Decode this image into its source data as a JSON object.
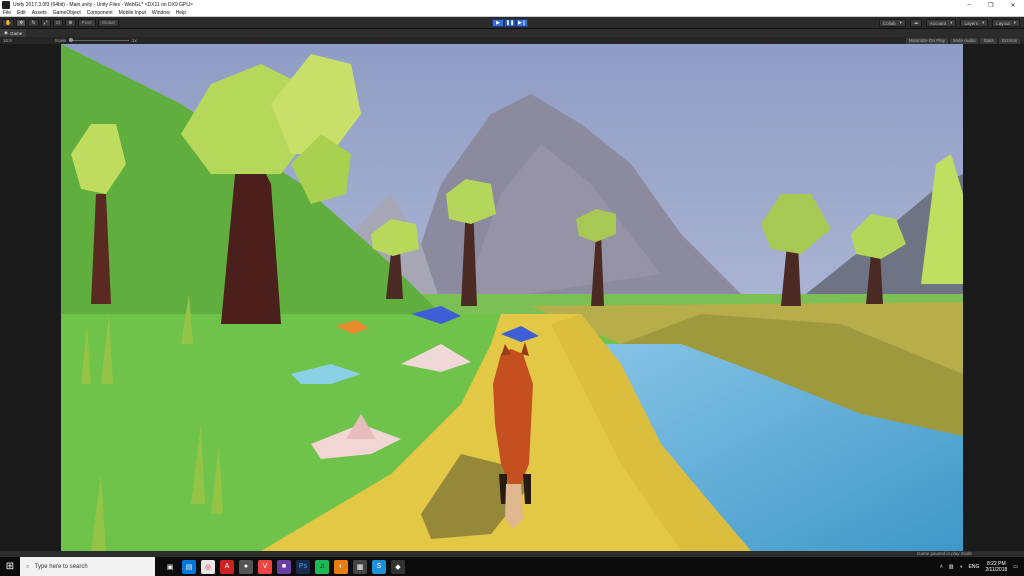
{
  "window": {
    "title": "Unity 2017.3.0f3 (64bit) - Main.unity - Unity Files - WebGL* <DX11 on DX9 GPU>",
    "controls": {
      "minimize": "–",
      "maximize": "❐",
      "close": "✕"
    }
  },
  "menu": {
    "items": [
      "File",
      "Edit",
      "Assets",
      "GameObject",
      "Component",
      "Mobile Input",
      "Window",
      "Help"
    ]
  },
  "toolbar": {
    "pivot_label": "Pivot",
    "global_label": "Global",
    "collab_label": "Collab",
    "account_label": "Account",
    "layers_label": "Layers",
    "layout_label": "Layout"
  },
  "game_view": {
    "tab_label": "Game",
    "display_label": "16:9",
    "scale_label": "Scale",
    "scale_value": "1x",
    "maximize_label": "Maximize On Play",
    "mute_label": "Mute Audio",
    "stats_label": "Stats",
    "gizmos_label": "Gizmos"
  },
  "status": {
    "message": "Game paused in play mode"
  },
  "taskbar": {
    "search_placeholder": "Type here to search",
    "language": "ENG",
    "time": "8:22 PM",
    "date": "2/11/2018"
  },
  "colors": {
    "sky_top": "#8f9cc4",
    "sky_bottom": "#c3cbe0",
    "grass": "#6fc24a",
    "path": "#e2c845",
    "water": "#5aaed6",
    "fox": "#c4501f"
  }
}
